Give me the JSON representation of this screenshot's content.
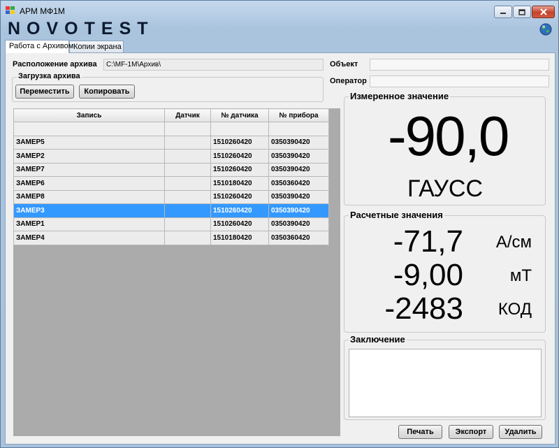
{
  "window": {
    "title": "АРМ МФ1М",
    "logo_text": "NOVOTEST"
  },
  "tabs": [
    {
      "label": "Работа с Архивом",
      "active": true
    },
    {
      "label": "Копии экрана",
      "active": false
    }
  ],
  "archive": {
    "location_label": "Расположение архива",
    "location_value": "C:\\MF-1M\\Архив\\",
    "load_group_title": "Загрузка архива",
    "move_button": "Переместить",
    "copy_button": "Копировать"
  },
  "info": {
    "object_label": "Объект",
    "object_value": "",
    "operator_label": "Оператор",
    "operator_value": ""
  },
  "table": {
    "headers": [
      "Запись",
      "Датчик",
      "№ датчика",
      "№ прибора"
    ],
    "rows": [
      {
        "record": "",
        "sensor": "",
        "sensor_no": "",
        "device_no": "",
        "selected": false
      },
      {
        "record": "ЗАМЕР5",
        "sensor": "",
        "sensor_no": "1510260420",
        "device_no": "0350390420",
        "selected": false
      },
      {
        "record": "ЗАМЕР2",
        "sensor": "",
        "sensor_no": "1510260420",
        "device_no": "0350390420",
        "selected": false
      },
      {
        "record": "ЗАМЕР7",
        "sensor": "",
        "sensor_no": "1510260420",
        "device_no": "0350390420",
        "selected": false
      },
      {
        "record": "ЗАМЕР6",
        "sensor": "",
        "sensor_no": "1510180420",
        "device_no": "0350360420",
        "selected": false
      },
      {
        "record": "ЗАМЕР8",
        "sensor": "",
        "sensor_no": "1510260420",
        "device_no": "0350390420",
        "selected": false
      },
      {
        "record": "ЗАМЕР3",
        "sensor": "",
        "sensor_no": "1510260420",
        "device_no": "0350390420",
        "selected": true
      },
      {
        "record": "ЗАМЕР1",
        "sensor": "",
        "sensor_no": "1510260420",
        "device_no": "0350390420",
        "selected": false
      },
      {
        "record": "ЗАМЕР4",
        "sensor": "",
        "sensor_no": "1510180420",
        "device_no": "0350360420",
        "selected": false
      }
    ]
  },
  "measured": {
    "title": "Измеренное значение",
    "value": "-90,0",
    "unit": "ГАУСС"
  },
  "calculated": {
    "title": "Расчетные значения",
    "items": [
      {
        "value": "-71,7",
        "unit": "А/см"
      },
      {
        "value": "-9,00",
        "unit": "мТ"
      },
      {
        "value": "-2483",
        "unit": "КОД"
      }
    ]
  },
  "conclusion": {
    "title": "Заключение",
    "text": ""
  },
  "actions": {
    "print": "Печать",
    "export": "Экспорт",
    "delete": "Удалить"
  },
  "colors": {
    "selection": "#3399ff",
    "window_frame": "#aac4de",
    "close_button": "#c4432b"
  },
  "icons": [
    "app-icon",
    "minimize-icon",
    "maximize-icon",
    "close-icon",
    "globe-icon"
  ]
}
